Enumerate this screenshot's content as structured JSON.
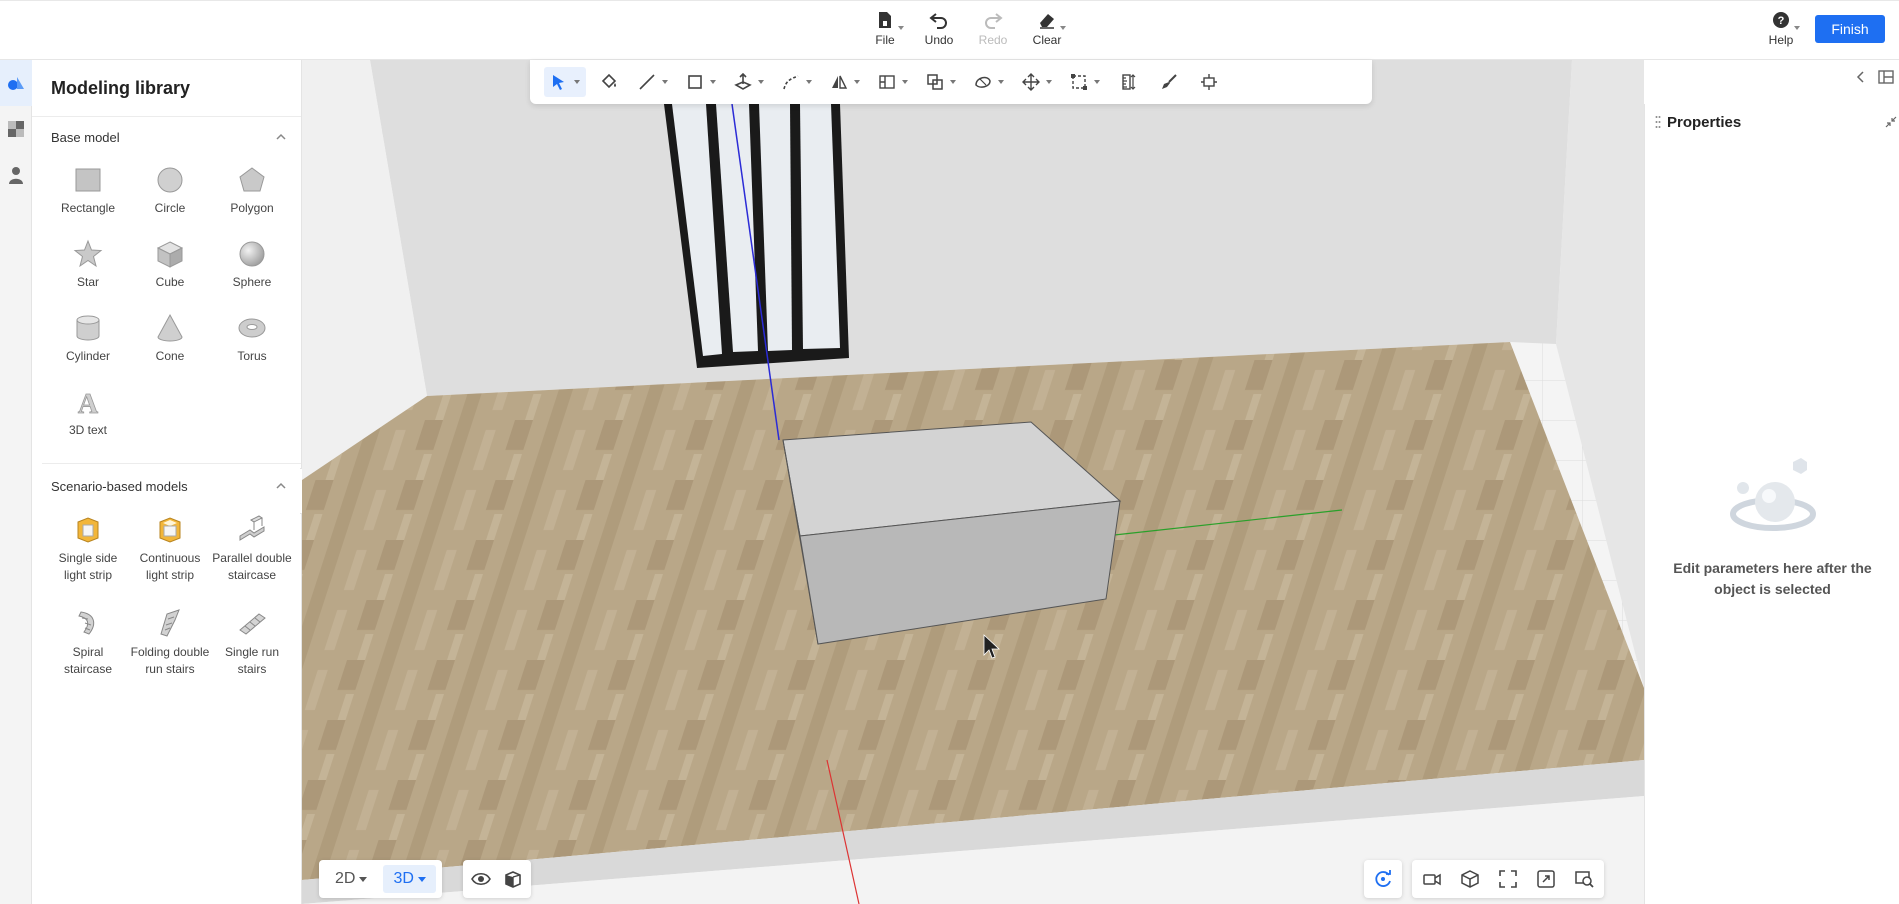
{
  "toolbar": {
    "file_label": "File",
    "undo_label": "Undo",
    "redo_label": "Redo",
    "clear_label": "Clear",
    "help_label": "Help",
    "finish_label": "Finish"
  },
  "library": {
    "title": "Modeling library",
    "base_section": "Base model",
    "base_items": [
      {
        "label": "Rectangle",
        "icon": "rectangle-icon"
      },
      {
        "label": "Circle",
        "icon": "circle-icon"
      },
      {
        "label": "Polygon",
        "icon": "polygon-icon"
      },
      {
        "label": "Star",
        "icon": "star-icon"
      },
      {
        "label": "Cube",
        "icon": "cube-icon"
      },
      {
        "label": "Sphere",
        "icon": "sphere-icon"
      },
      {
        "label": "Cylinder",
        "icon": "cylinder-icon"
      },
      {
        "label": "Cone",
        "icon": "cone-icon"
      },
      {
        "label": "Torus",
        "icon": "torus-icon"
      },
      {
        "label": "3D text",
        "icon": "text-3d-icon"
      }
    ],
    "scenario_section": "Scenario-based models",
    "scenario_items": [
      {
        "label": "Single side light strip",
        "icon": "single-light-strip-icon"
      },
      {
        "label": "Continuous light strip",
        "icon": "continuous-light-strip-icon"
      },
      {
        "label": "Parallel double staircase",
        "icon": "parallel-staircase-icon"
      },
      {
        "label": "Spiral staircase",
        "icon": "spiral-staircase-icon"
      },
      {
        "label": "Folding double run stairs",
        "icon": "folding-stairs-icon"
      },
      {
        "label": "Single run stairs",
        "icon": "single-run-stairs-icon"
      }
    ]
  },
  "properties": {
    "title": "Properties",
    "empty_message": "Edit parameters here after the object is selected"
  },
  "view": {
    "mode_2d": "2D",
    "mode_3d": "3D",
    "active_mode": "3D"
  },
  "colors": {
    "accent": "#1e6ff2",
    "floor": "#b8a587",
    "wall": "#dcdcdc",
    "cube_front": "#b7b7b7",
    "cube_top": "#d2d2d2"
  }
}
